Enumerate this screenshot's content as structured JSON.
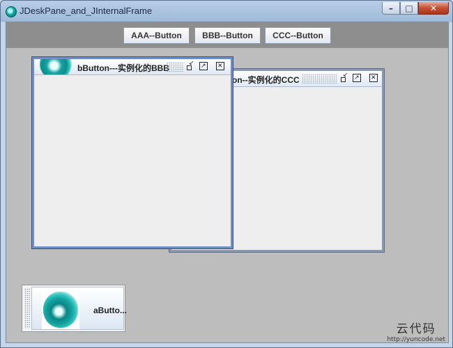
{
  "window": {
    "title": "JDeskPane_and_JInternalFrame",
    "controls": {
      "minimize": "–",
      "maximize": "□",
      "close": "✕"
    }
  },
  "toolbar": {
    "buttons": [
      "AAA--Button",
      "BBB--Button",
      "CCC--Button"
    ]
  },
  "frames": {
    "active": {
      "title": "bButton---实例化的BBB"
    },
    "inactive": {
      "title": "ton--实例化的CCC"
    }
  },
  "iconified": {
    "label": "aButto..."
  },
  "watermark": {
    "text": "云代码",
    "url": "http://yuncode.net"
  },
  "colors": {
    "desktop": "#bdbdbd",
    "toolbar": "#8e8e8e",
    "active_frame_border": "#6f8fc4"
  }
}
